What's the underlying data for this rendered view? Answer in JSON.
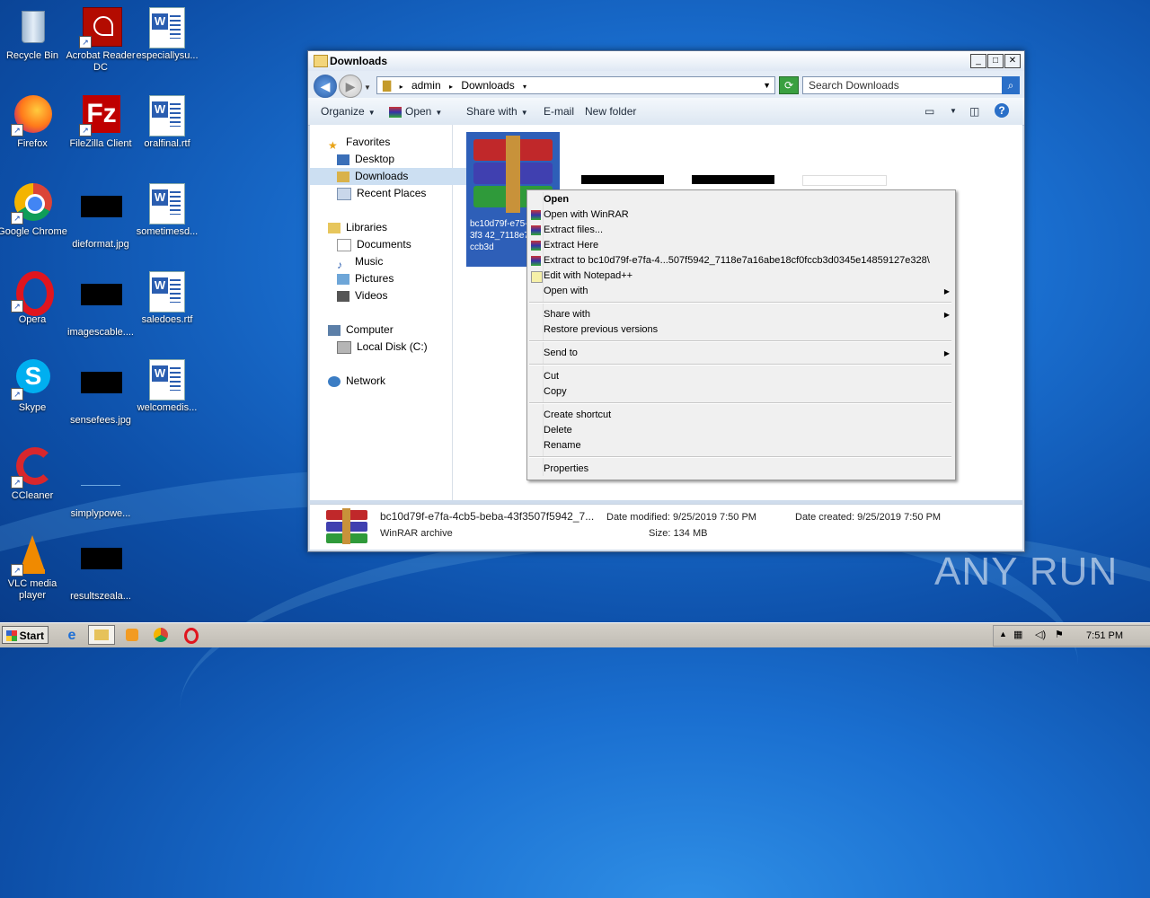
{
  "desktop": {
    "icons": [
      {
        "label": "Recycle Bin",
        "icon": "recycle-bin-icon"
      },
      {
        "label": "Acrobat Reader DC",
        "icon": "acrobat-icon"
      },
      {
        "label": "especiallysu...",
        "icon": "word-doc-icon"
      },
      {
        "label": "Firefox",
        "icon": "firefox-icon"
      },
      {
        "label": "FileZilla Client",
        "icon": "filezilla-icon"
      },
      {
        "label": "oralfinal.rtf",
        "icon": "word-doc-icon"
      },
      {
        "label": "Google Chrome",
        "icon": "chrome-icon"
      },
      {
        "label": "dieformat.jpg",
        "icon": "image-thumb-icon"
      },
      {
        "label": "sometimesd...",
        "icon": "word-doc-icon"
      },
      {
        "label": "Opera",
        "icon": "opera-icon"
      },
      {
        "label": "imagescable....",
        "icon": "image-thumb-icon"
      },
      {
        "label": "saledoes.rtf",
        "icon": "word-doc-icon"
      },
      {
        "label": "Skype",
        "icon": "skype-icon"
      },
      {
        "label": "sensefees.jpg",
        "icon": "image-thumb-icon"
      },
      {
        "label": "welcomedis...",
        "icon": "word-doc-icon"
      },
      {
        "label": "CCleaner",
        "icon": "ccleaner-icon"
      },
      {
        "label": "simplypowe...",
        "icon": "blank-file-icon"
      },
      {
        "label": "VLC media player",
        "icon": "vlc-icon"
      },
      {
        "label": "resultszeala...",
        "icon": "image-thumb-icon"
      }
    ]
  },
  "window": {
    "title": "Downloads",
    "address": [
      "admin",
      "Downloads"
    ],
    "search_placeholder": "Search Downloads",
    "toolbar": {
      "organize": "Organize",
      "open": "Open",
      "share_with": "Share with",
      "email": "E-mail",
      "new_folder": "New folder"
    },
    "nav": {
      "favorites": "Favorites",
      "desktop": "Desktop",
      "downloads": "Downloads",
      "recent": "Recent Places",
      "libraries": "Libraries",
      "documents": "Documents",
      "music": "Music",
      "pictures": "Pictures",
      "videos": "Videos",
      "computer": "Computer",
      "local_disk": "Local Disk (C:)",
      "network": "Network"
    },
    "selected_file": {
      "name_visible": "bc10d79f-e75-beba-43f3 42_7118e718cf0fccb3d"
    },
    "status": {
      "filename": "bc10d79f-e7fa-4cb5-beba-43f3507f5942_7...",
      "type": "WinRAR archive",
      "modified_label": "Date modified:",
      "modified_value": "9/25/2019 7:50 PM",
      "size_label": "Size:",
      "size_value": "134 MB",
      "created_label": "Date created:",
      "created_value": "9/25/2019 7:50 PM"
    }
  },
  "context_menu": {
    "open": "Open",
    "open_winrar": "Open with WinRAR",
    "extract_files": "Extract files...",
    "extract_here": "Extract Here",
    "extract_to": "Extract to bc10d79f-e7fa-4...507f5942_7118e7a16abe18cf0fccb3d0345e14859127e328\\",
    "edit_notepad": "Edit with Notepad++",
    "open_with": "Open with",
    "share_with": "Share with",
    "restore": "Restore previous versions",
    "send_to": "Send to",
    "cut": "Cut",
    "copy": "Copy",
    "create_shortcut": "Create shortcut",
    "delete": "Delete",
    "rename": "Rename",
    "properties": "Properties"
  },
  "taskbar": {
    "start": "Start",
    "clock": "7:51 PM"
  },
  "watermark": "ANY RUN"
}
